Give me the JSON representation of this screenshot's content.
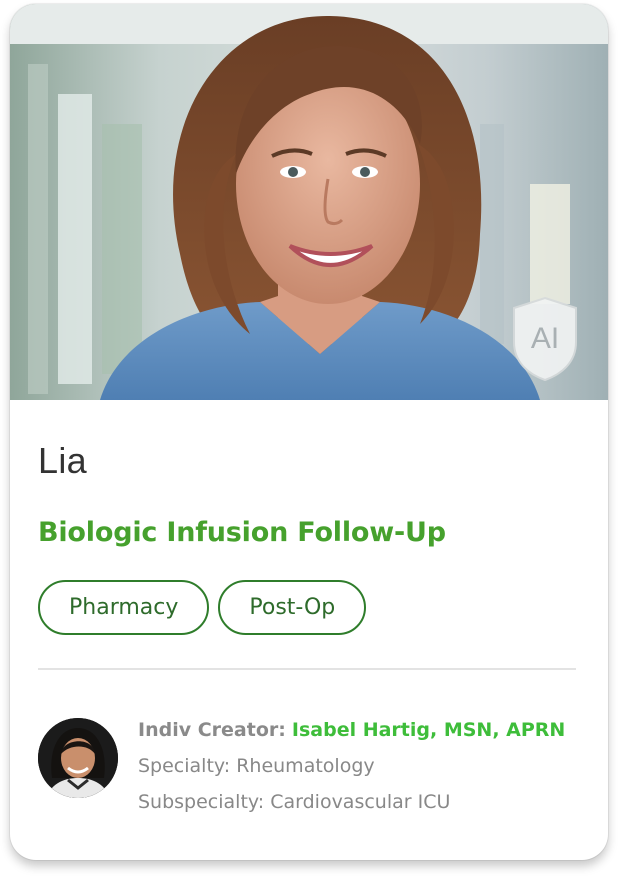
{
  "card": {
    "name": "Lia",
    "badge_text": "AI",
    "title": "Biologic Infusion Follow-Up",
    "tags": [
      "Pharmacy",
      "Post-Op"
    ]
  },
  "creator": {
    "label": "Indiv Creator:",
    "name": "Isabel Hartig, MSN, APRN",
    "specialty": "Specialty: Rheumatology",
    "subspecialty": "Subspecialty: Cardiovascular ICU"
  },
  "colors": {
    "title_green": "#46a12d",
    "creator_green": "#3ebd3a",
    "tag_border": "#2f7d2b"
  }
}
